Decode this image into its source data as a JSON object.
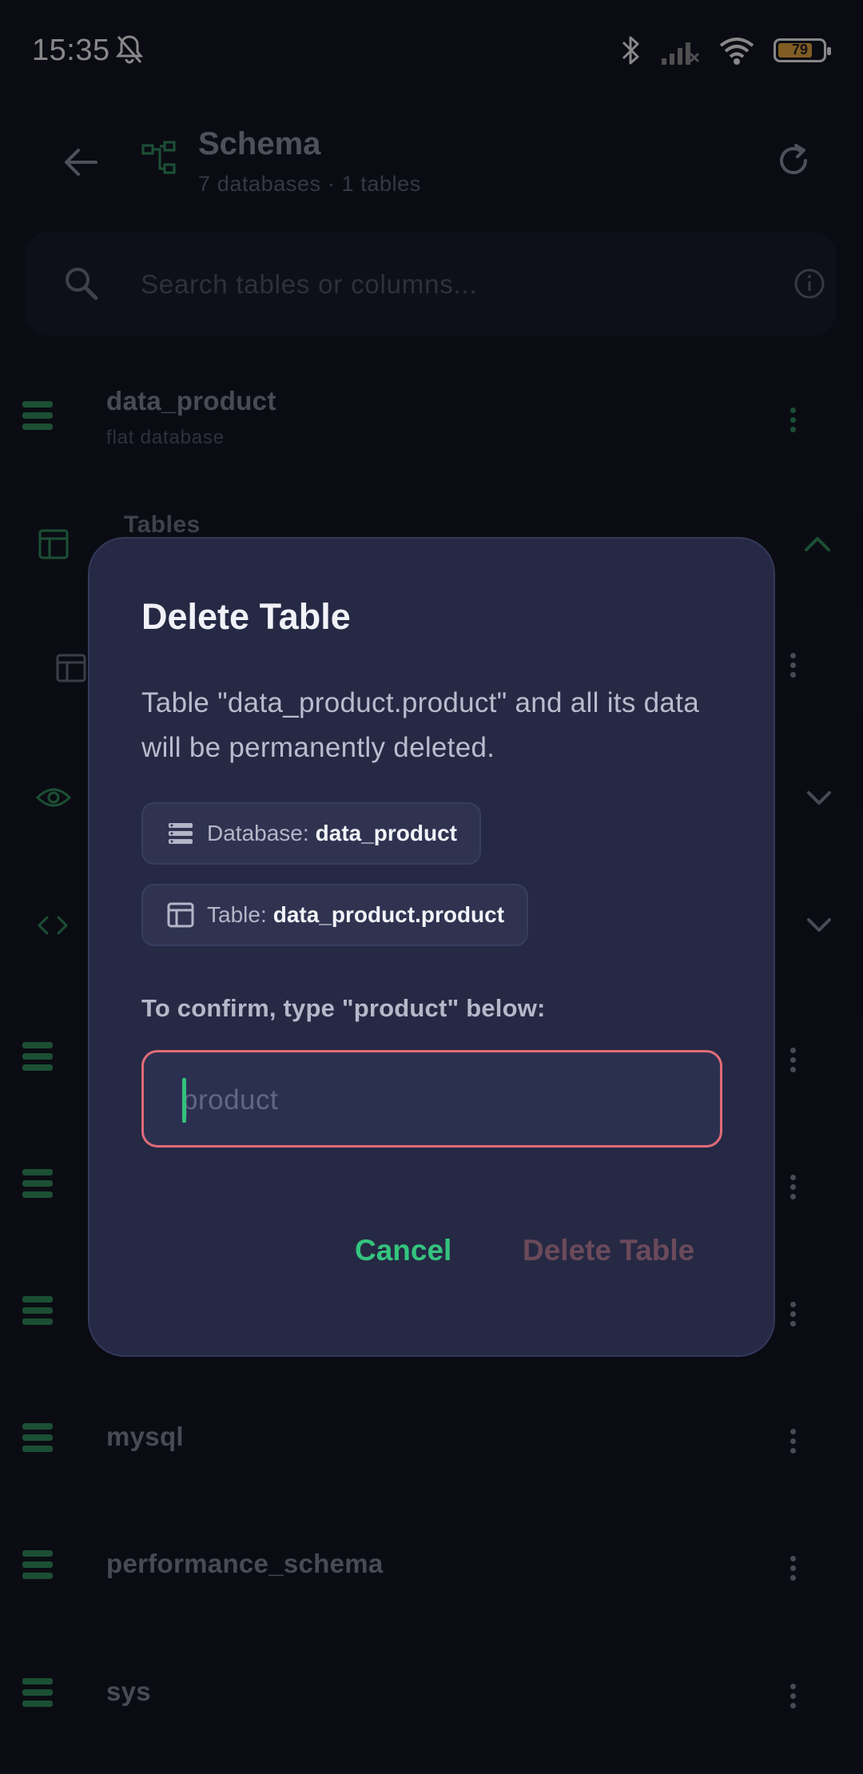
{
  "status_bar": {
    "time": "15:35",
    "battery_level": "79",
    "icons": [
      "bell-off-icon",
      "bluetooth-icon",
      "signal-icon",
      "wifi-icon",
      "battery-icon"
    ]
  },
  "app_bar": {
    "title": "Schema",
    "subtitle": "7 databases · 1 tables",
    "icons": [
      "back-arrow-icon",
      "schema-tree-icon",
      "refresh-icon"
    ]
  },
  "search": {
    "placeholder": "Search tables or columns...",
    "icons": [
      "search-icon",
      "info-icon"
    ]
  },
  "background_list": {
    "databases": [
      {
        "name": "data_product",
        "subtitle": "flat database"
      },
      {
        "name": "mysql"
      },
      {
        "name": "performance_schema"
      },
      {
        "name": "sys"
      }
    ],
    "sections": [
      {
        "label": "Tables"
      }
    ]
  },
  "dialog": {
    "title": "Delete Table",
    "message": "Table \"data_product.product\" and all its data will be permanently deleted.",
    "chips": [
      {
        "label": "Database:",
        "value": "data_product",
        "icon": "database-icon"
      },
      {
        "label": "Table:",
        "value": "data_product.product",
        "icon": "table-icon"
      }
    ],
    "confirm_label": "To confirm, type \"product\" below:",
    "confirm_input": {
      "value": "",
      "placeholder": "product"
    },
    "cancel_label": "Cancel",
    "delete_label": "Delete Table"
  },
  "colors": {
    "accent_green": "#34c47e",
    "danger_border": "#e06c78",
    "dialog_bg": "#262944",
    "screen_bg": "#0f111a"
  }
}
